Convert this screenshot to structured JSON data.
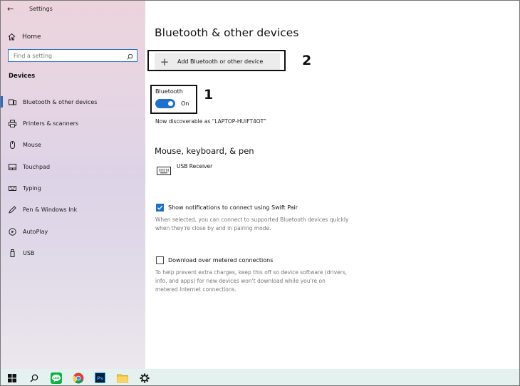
{
  "window": {
    "title": "Settings"
  },
  "sidebar": {
    "home_label": "Home",
    "search_placeholder": "Find a setting",
    "section_label": "Devices",
    "items": [
      {
        "label": "Bluetooth & other devices",
        "icon": "bluetooth-devices-icon",
        "active": true
      },
      {
        "label": "Printers & scanners",
        "icon": "printer-icon",
        "active": false
      },
      {
        "label": "Mouse",
        "icon": "mouse-icon",
        "active": false
      },
      {
        "label": "Touchpad",
        "icon": "touchpad-icon",
        "active": false
      },
      {
        "label": "Typing",
        "icon": "keyboard-icon",
        "active": false
      },
      {
        "label": "Pen & Windows Ink",
        "icon": "pen-icon",
        "active": false
      },
      {
        "label": "AutoPlay",
        "icon": "autoplay-icon",
        "active": false
      },
      {
        "label": "USB",
        "icon": "usb-icon",
        "active": false
      }
    ]
  },
  "main": {
    "title": "Bluetooth & other devices",
    "add_device": {
      "label": "Add Bluetooth or other device",
      "icon": "plus-icon"
    },
    "bluetooth": {
      "label": "Bluetooth",
      "state": "On",
      "enabled": true,
      "discoverable_text": "Now discoverable as “LAPTOP-HUIFT4OT”"
    },
    "mouse_section": {
      "title": "Mouse, keyboard, & pen",
      "devices": [
        {
          "name": "USB Receiver",
          "icon": "keyboard-icon"
        }
      ]
    },
    "swift_pair": {
      "label": "Show notifications to connect using Swift Pair",
      "checked": true,
      "description": [
        "When selected, you can connect to supported Bluetooth devices quickly",
        "when they're close by and in pairing mode."
      ]
    },
    "metered": {
      "label": "Download over metered connections",
      "checked": false,
      "description": [
        "To help prevent extra charges, keep this off so device software (drivers,",
        "info, and apps) for new devices won't download while you're on",
        "metered Internet connections."
      ]
    }
  },
  "annotations": [
    {
      "number": "1",
      "target": "bluetooth-toggle"
    },
    {
      "number": "2",
      "target": "add-device-button"
    }
  ],
  "taskbar": {
    "items": [
      {
        "icon": "windows-start-icon"
      },
      {
        "icon": "search-icon"
      },
      {
        "icon": "line-app-icon",
        "text": "LINE"
      },
      {
        "icon": "chrome-icon"
      },
      {
        "icon": "photoshop-icon",
        "text": "Ps"
      },
      {
        "icon": "file-explorer-icon"
      },
      {
        "icon": "settings-gear-icon",
        "active": true
      }
    ]
  },
  "colors": {
    "accent": "#1f6fd1",
    "taskbar": "#e4f1ee",
    "sidebar_top": "#ecd3dc",
    "sidebar_bottom": "#ece7ee"
  }
}
